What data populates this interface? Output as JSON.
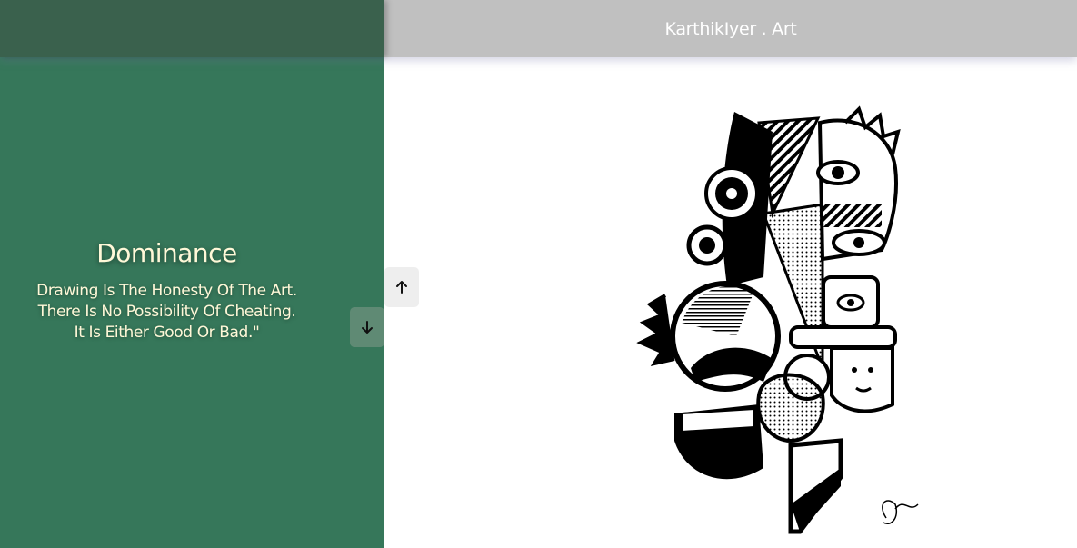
{
  "header": {
    "brand": "KarthikIyer . Art"
  },
  "artwork": {
    "title": "Dominance",
    "quote_lines": [
      "Drawing Is The Honesty Of The Art.",
      "There Is No Possibility Of Cheating.",
      "It Is Either Good Or Bad.\""
    ]
  },
  "navigation": {
    "prev_icon": "arrow-up-icon",
    "next_icon": "arrow-down-icon"
  },
  "colors": {
    "panel": "#36775a",
    "header_left": "#3a614d",
    "header": "#c0c0c0",
    "text": "#fff8d8"
  }
}
